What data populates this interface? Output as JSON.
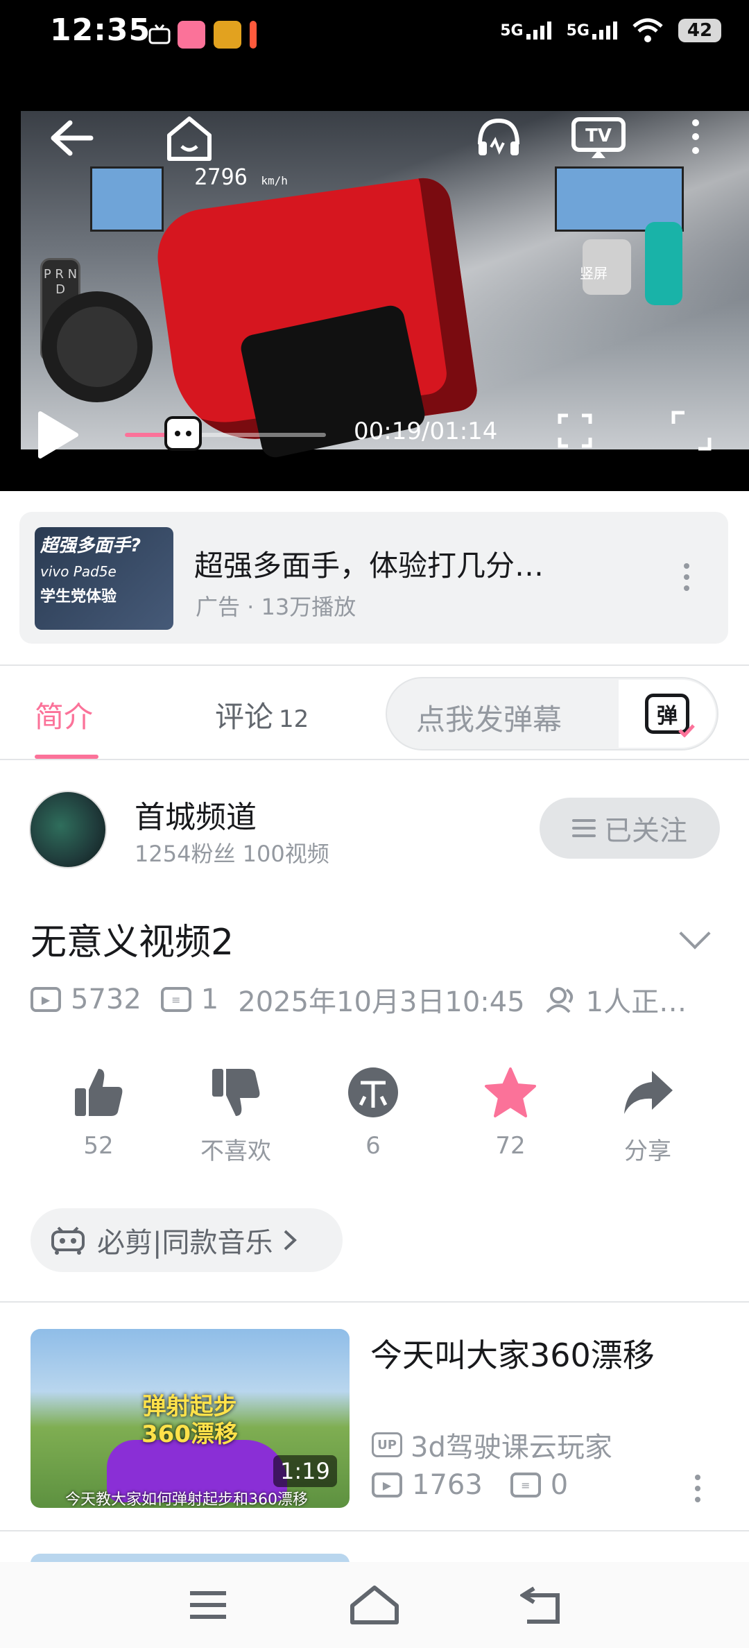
{
  "status_bar": {
    "time": "12:35",
    "network1": "5G",
    "network2": "5G",
    "battery": "42"
  },
  "player": {
    "current_time": "00:19",
    "total_time": "01:14",
    "time_display": "00:19/01:14",
    "progress": 0.26,
    "game_speed": "2796",
    "game_speed_unit": "km/h",
    "portrait_label": "竖屏",
    "gear_letters": "P R N D"
  },
  "ad": {
    "thumb_title": "超强多面手?",
    "thumb_line1": "vivo Pad5e",
    "thumb_line2": "学生党体验",
    "title": "超强多面手，体验打几分…",
    "subtitle": "广告 · 13万播放"
  },
  "tabs": {
    "intro": "简介",
    "comments": "评论",
    "comments_count": "12",
    "danmaku_placeholder": "点我发弹幕",
    "danmaku_btn": "弹"
  },
  "uploader": {
    "name": "首城频道",
    "stats": "1254粉丝   100视频",
    "follow_label": "已关注"
  },
  "video": {
    "title": "无意义视频2",
    "views": "5732",
    "danmaku": "1",
    "date": "2025年10月3日10:45",
    "watching": "1人正…"
  },
  "actions": [
    {
      "label": "52",
      "icon": "like-icon"
    },
    {
      "label": "不喜欢",
      "icon": "dislike-icon"
    },
    {
      "label": "6",
      "icon": "coin-icon"
    },
    {
      "label": "72",
      "icon": "favorite-icon"
    },
    {
      "label": "分享",
      "icon": "share-icon"
    }
  ],
  "music_pill": {
    "label": "必剪|同款音乐"
  },
  "related": [
    {
      "title": "今天叫大家360漂移",
      "overlay_line1": "弹射起步",
      "overlay_line2": "360漂移",
      "caption": "今天教大家如何弹射起步和360漂移",
      "duration": "1:19",
      "up_badge": "UP",
      "uploader": "3d驾驶课云玩家",
      "views": "1763",
      "danmaku": "0"
    }
  ],
  "colors": {
    "accent": "#fb7299",
    "text_secondary": "#9499a0",
    "bg_gray": "#f1f2f3"
  }
}
